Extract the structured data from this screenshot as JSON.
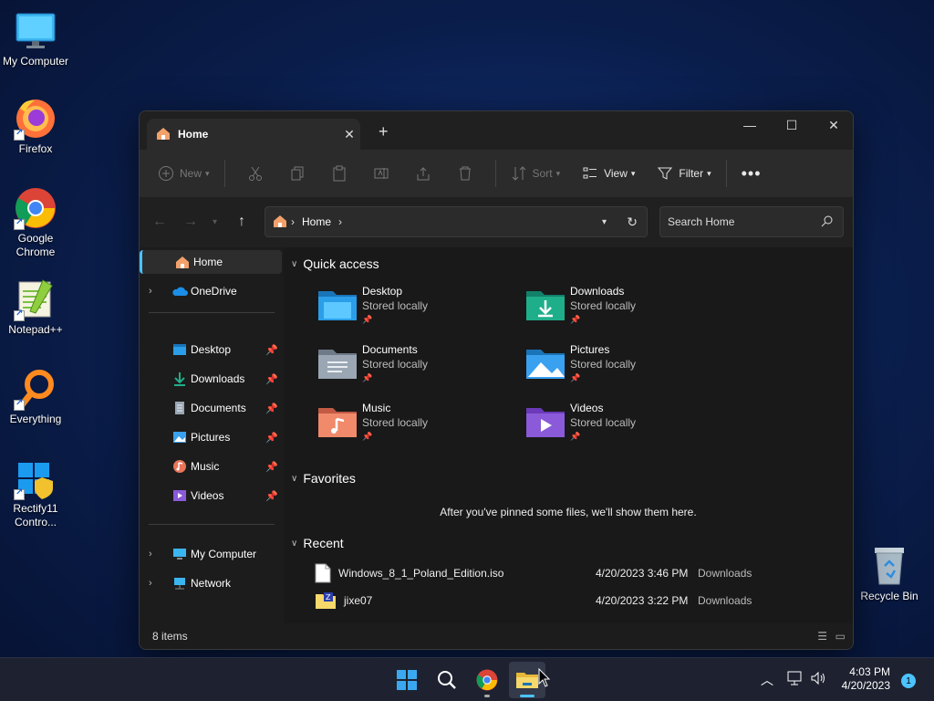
{
  "desktop": {
    "icons": [
      {
        "label": "My Computer"
      },
      {
        "label": "Firefox"
      },
      {
        "label": "Google Chrome"
      },
      {
        "label": "Notepad++"
      },
      {
        "label": "Everything"
      },
      {
        "label": "Rectify11 Contro..."
      },
      {
        "label": "Recycle Bin"
      }
    ]
  },
  "explorer": {
    "tab_title": "Home",
    "toolbar": {
      "new_label": "New",
      "sort_label": "Sort",
      "view_label": "View",
      "filter_label": "Filter"
    },
    "address": {
      "location": "Home"
    },
    "search": {
      "placeholder": "Search Home"
    },
    "sidebar": {
      "items": [
        {
          "label": "Home"
        },
        {
          "label": "OneDrive"
        },
        {
          "label": "Desktop"
        },
        {
          "label": "Downloads"
        },
        {
          "label": "Documents"
        },
        {
          "label": "Pictures"
        },
        {
          "label": "Music"
        },
        {
          "label": "Videos"
        },
        {
          "label": "My Computer"
        },
        {
          "label": "Network"
        }
      ]
    },
    "quick_access": {
      "title": "Quick access",
      "items": [
        {
          "name": "Desktop",
          "status": "Stored locally",
          "color": "#2a9ee8"
        },
        {
          "name": "Downloads",
          "status": "Stored locally",
          "color": "#1fae8a"
        },
        {
          "name": "Documents",
          "status": "Stored locally",
          "color": "#8e9bab"
        },
        {
          "name": "Pictures",
          "status": "Stored locally",
          "color": "#3aa0f0"
        },
        {
          "name": "Music",
          "status": "Stored locally",
          "color": "#e8755a"
        },
        {
          "name": "Videos",
          "status": "Stored locally",
          "color": "#8a5ad8"
        }
      ]
    },
    "favorites": {
      "title": "Favorites",
      "empty_text": "After you've pinned some files, we'll show them here."
    },
    "recent": {
      "title": "Recent",
      "rows": [
        {
          "name": "Windows_8_1_Poland_Edition.iso",
          "date": "4/20/2023 3:46 PM",
          "location": "Downloads"
        },
        {
          "name": "jixe07",
          "date": "4/20/2023 3:22 PM",
          "location": "Downloads"
        }
      ]
    },
    "status": {
      "item_count": "8 items"
    }
  },
  "taskbar": {
    "time": "4:03 PM",
    "date": "4/20/2023",
    "notification_count": "1"
  }
}
